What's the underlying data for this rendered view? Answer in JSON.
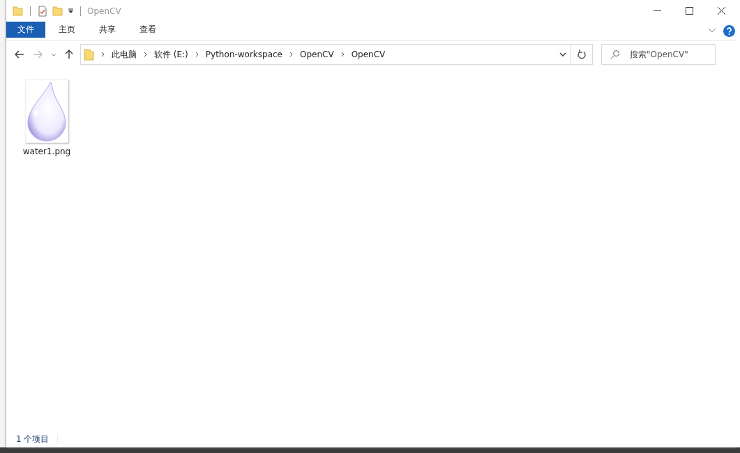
{
  "window": {
    "title": "OpenCV"
  },
  "ribbon_tabs": [
    {
      "label": "文件",
      "selected": true
    },
    {
      "label": "主页",
      "selected": false
    },
    {
      "label": "共享",
      "selected": false
    },
    {
      "label": "查看",
      "selected": false
    }
  ],
  "address_bar": {
    "path": [
      "此电脑",
      "软件 (E:)",
      "Python-workspace",
      "OpenCV",
      "OpenCV"
    ]
  },
  "search": {
    "placeholder": "搜索\"OpenCV\""
  },
  "files": [
    {
      "name": "water1.png",
      "kind": "picture"
    }
  ],
  "status_bar": {
    "item_count": "1 个项目"
  }
}
